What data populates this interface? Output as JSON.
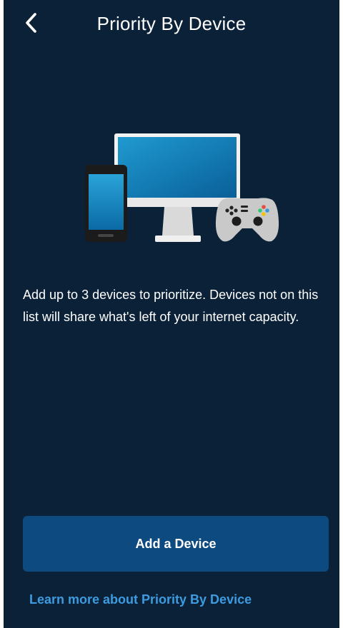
{
  "header": {
    "back_icon": "chevron-left-icon",
    "title": "Priority By Device"
  },
  "illustration": {
    "icons": [
      "phone-icon",
      "monitor-icon",
      "gamepad-icon"
    ]
  },
  "main": {
    "description": "Add up to 3 devices to prioritize. Devices not on this list will share what's left of your internet capacity."
  },
  "actions": {
    "add_device_label": "Add a Device",
    "learn_more_label": "Learn more about Priority By Device"
  },
  "colors": {
    "background": "#0b2138",
    "button": "#0d4a80",
    "link": "#3d9be0",
    "text": "#ffffff"
  }
}
